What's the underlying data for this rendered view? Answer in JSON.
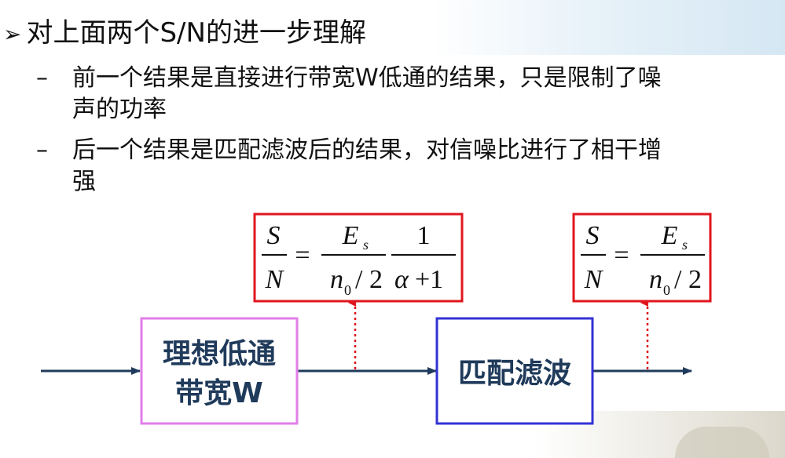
{
  "heading": "对上面两个S/N的进一步理解",
  "bullets": [
    {
      "dash": "–",
      "line1": "前一个结果是直接进行带宽W低通的结果，只是限制了噪",
      "line2": "声的功率"
    },
    {
      "dash": "–",
      "line1": "后一个结果是匹配滤波后的结果，对信噪比进行了相干增",
      "line2": "强"
    }
  ],
  "blocks": {
    "lowpass_line1": "理想低通",
    "lowpass_line2": "带宽W",
    "matched": "匹配滤波"
  },
  "formula1": {
    "S": "S",
    "N": "N",
    "eq": "=",
    "E": "E",
    "s": "s",
    "n": "n",
    "zero": "0",
    "slash2": "/ 2",
    "one": "1",
    "alpha": "α",
    "plus1": "+1"
  },
  "formula2": {
    "S": "S",
    "N": "N",
    "eq": "=",
    "E": "E",
    "s": "s",
    "n": "n",
    "zero": "0",
    "slash2": "/ 2"
  },
  "colors": {
    "formula_border": "#e0161e",
    "lowpass_border": "#e27ee8",
    "matched_border": "#3232d6",
    "arrow": "#1f3a5a",
    "probe": "#e0161e"
  }
}
